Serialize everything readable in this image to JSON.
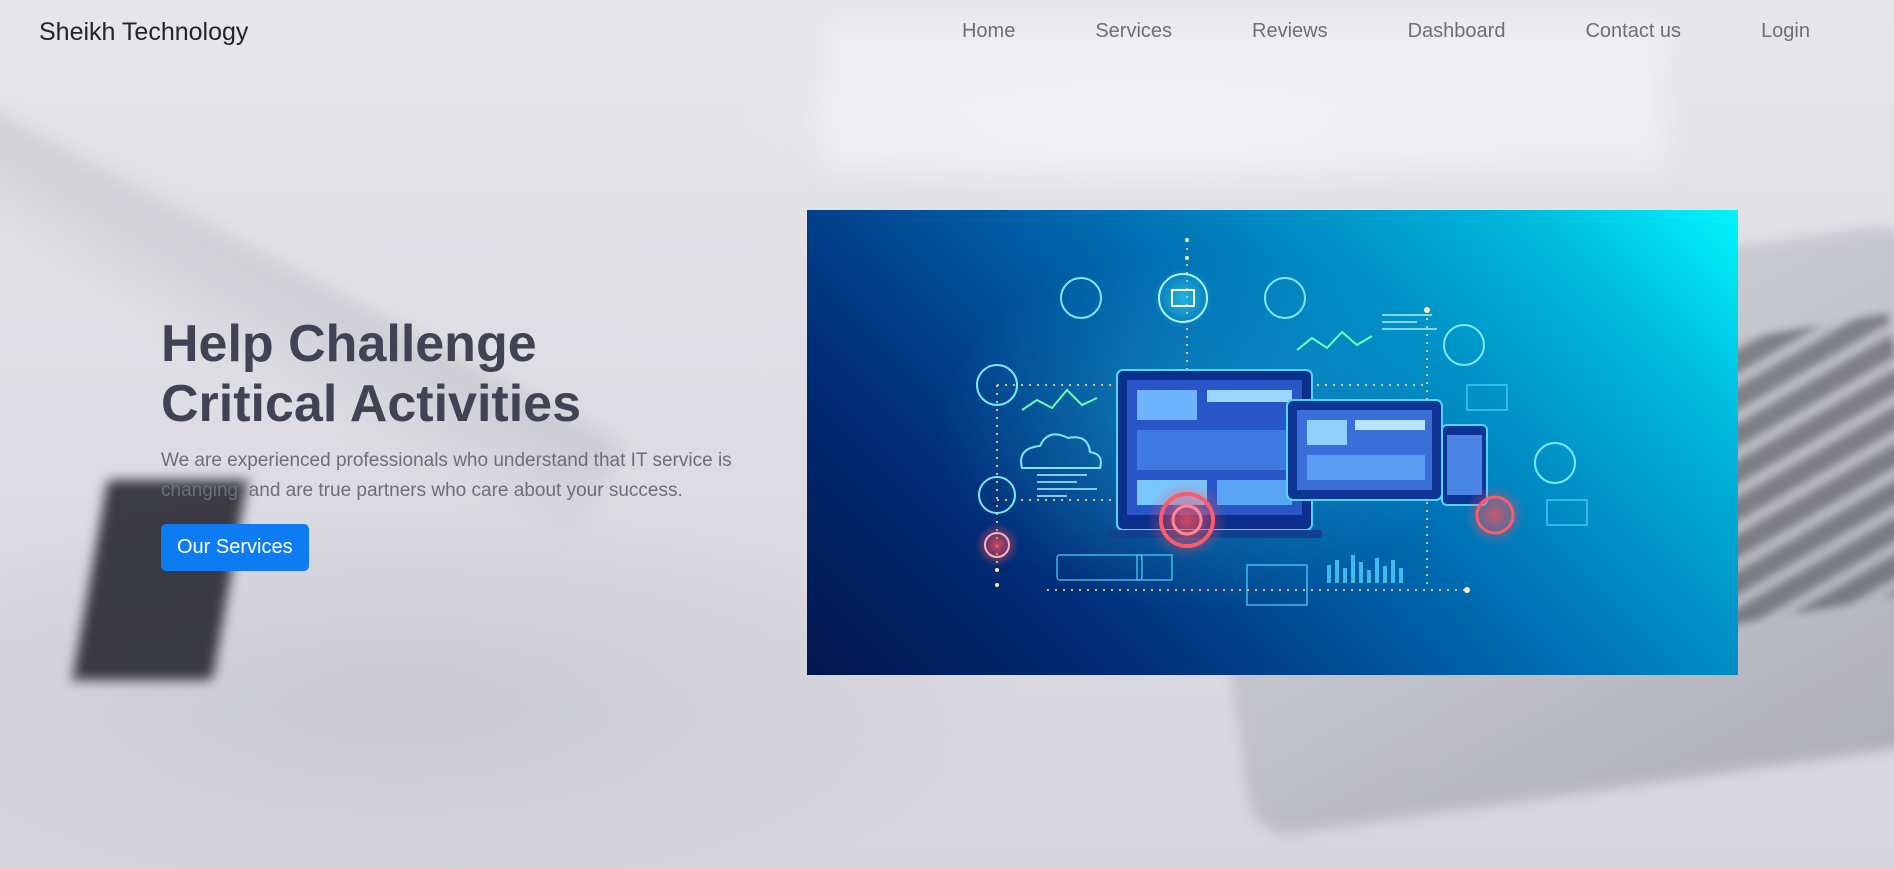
{
  "brand": "Sheikh Technology",
  "nav": [
    "Home",
    "Services",
    "Reviews",
    "Dashboard",
    "Contact us",
    "Login"
  ],
  "hero": {
    "title_line1": "Help Challenge",
    "title_line2": "Critical Activities",
    "subtitle": "We are experienced professionals who understand that IT service is changing, and are true partners who care about your success.",
    "button": "Our Services"
  },
  "colors": {
    "primary": "#0d7cf2",
    "heading": "#3f4354",
    "muted": "#6c6f77"
  }
}
